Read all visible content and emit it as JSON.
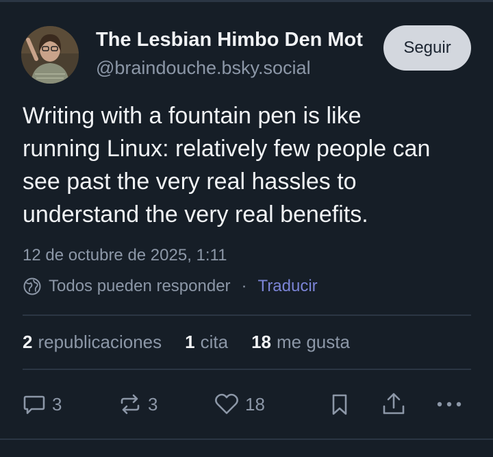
{
  "author": {
    "display_name": "The Lesbian Himbo Den Mot",
    "handle": "@braindouche.bsky.social"
  },
  "follow_button": {
    "label": "Seguir"
  },
  "post": {
    "lines": [
      "Writing with a fountain pen is like",
      "running Linux: relatively few people can",
      "see past the very real hassles to",
      "understand the very real benefits."
    ],
    "timestamp": "12 de octubre de 2025, 1:11",
    "reply_setting": "Todos pueden responder",
    "separator": "·",
    "translate_label": "Traducir"
  },
  "stats": {
    "reposts": {
      "count": "2",
      "label": "republicaciones"
    },
    "quotes": {
      "count": "1",
      "label": "cita"
    },
    "likes": {
      "count": "18",
      "label": "me gusta"
    }
  },
  "actions": {
    "reply": {
      "icon": "reply-icon",
      "count": "3"
    },
    "repost": {
      "icon": "repost-icon",
      "count": "3"
    },
    "like": {
      "icon": "heart-icon",
      "count": "18"
    },
    "bookmark": {
      "icon": "bookmark-icon"
    },
    "share": {
      "icon": "share-icon"
    },
    "more": {
      "icon": "more-icon"
    }
  },
  "colors": {
    "background": "#161e27",
    "text": "#f1f3f5",
    "muted": "#8c97a7",
    "link": "#7b84d6",
    "divider": "#2b3644",
    "follow_button_bg": "#d3d7de"
  }
}
